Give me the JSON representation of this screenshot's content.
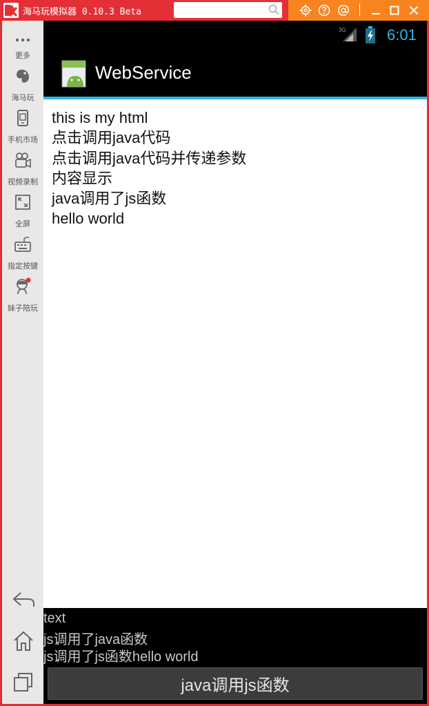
{
  "window": {
    "title": "海马玩模拟器 0.10.3 Beta",
    "search_placeholder": "",
    "colors": {
      "titlebar": "#e42f36",
      "titlebar_right": "#f7841f",
      "accent": "#33b5e5"
    },
    "titlebar_icons": [
      "settings-icon",
      "help-icon",
      "at-icon",
      "minimize-icon",
      "maximize-icon",
      "close-icon"
    ]
  },
  "sidebar": {
    "items": [
      {
        "label": "更多",
        "icon": "more-dots-icon"
      },
      {
        "label": "海马玩",
        "icon": "haima-logo-icon"
      },
      {
        "label": "手机市场",
        "icon": "phone-market-icon"
      },
      {
        "label": "视频录制",
        "icon": "video-record-icon"
      },
      {
        "label": "全屏",
        "icon": "fullscreen-icon"
      },
      {
        "label": "指定按键",
        "icon": "keyboard-icon"
      },
      {
        "label": "妹子陪玩",
        "icon": "girl-avatar-icon"
      }
    ],
    "bottom_icons": [
      "back-icon",
      "home-icon",
      "recent-apps-icon"
    ]
  },
  "statusbar": {
    "network": "3G",
    "time": "6:01"
  },
  "actionbar": {
    "title": "WebService"
  },
  "webview": {
    "lines": [
      "this is my html",
      "点击调用java代码",
      "点击调用java代码并传递参数",
      "内容显示",
      "java调用了js函数",
      "hello world"
    ]
  },
  "log": {
    "lines": [
      "text",
      "js调用了java函数",
      "js调用了js函数hello world"
    ]
  },
  "button": {
    "label": "java调用js函数"
  }
}
